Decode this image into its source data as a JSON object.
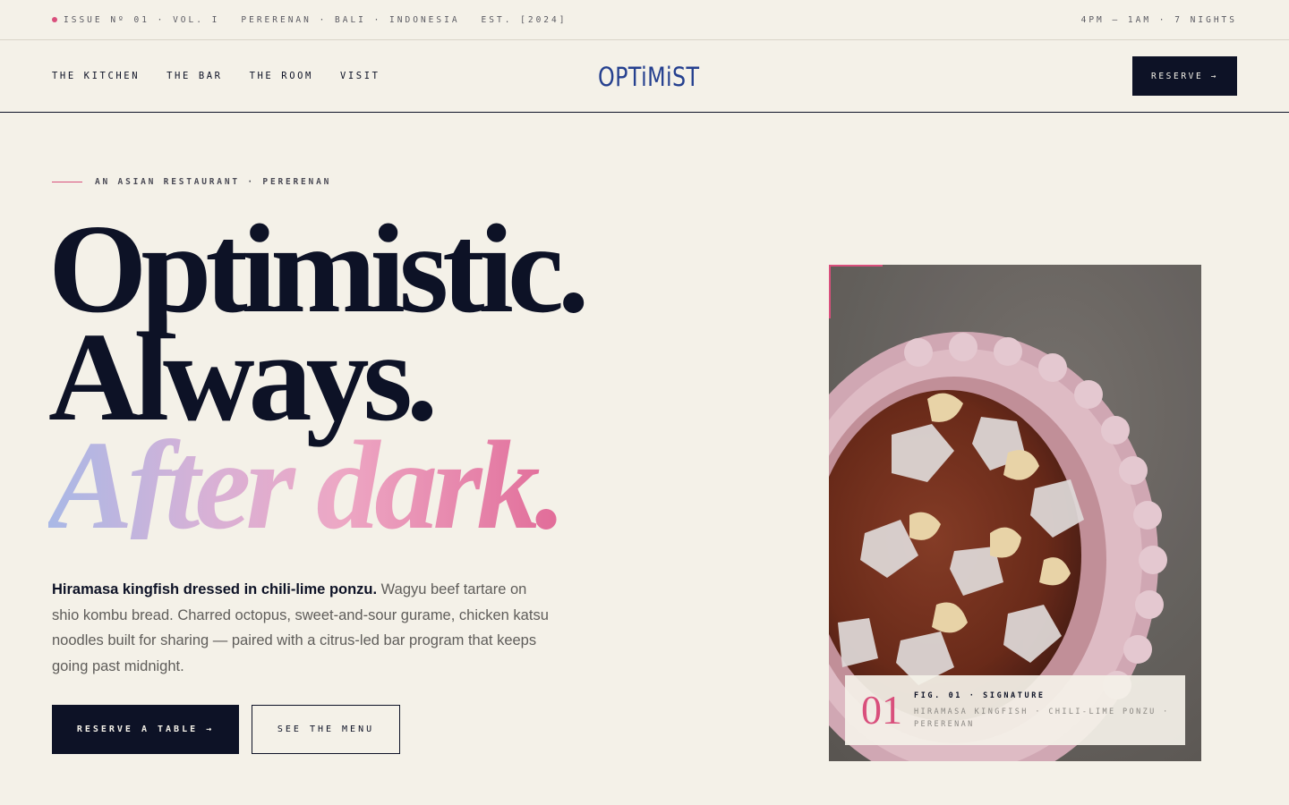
{
  "topbar": {
    "issue": "ISSUE Nº 01 · VOL. I",
    "location": "PERERENAN · BALI · INDONESIA",
    "established": "EST. [2024]",
    "hours": "4PM — 1AM · 7 NIGHTS"
  },
  "nav": {
    "links": [
      "THE KITCHEN",
      "THE BAR",
      "THE ROOM",
      "VISIT"
    ],
    "logo": "OPTiMiST",
    "reserve_label": "RESERVE →"
  },
  "hero": {
    "eyebrow": "AN ASIAN RESTAURANT · PERERENAN",
    "headline_line1": "Optimistic.",
    "headline_line2": "Always.",
    "headline_line3": "After dark.",
    "intro_strong": "Hiramasa kingfish dressed in chili-lime ponzu.",
    "intro_rest": " Wagyu beef tartare on shio kombu bread. Charred octopus, sweet-and-sour gurame, chicken katsu noodles built for sharing — paired with a citrus-led bar program that keeps going past midnight.",
    "primary_cta": "RESERVE A TABLE →",
    "secondary_cta": "SEE THE MENU"
  },
  "figure": {
    "number": "01",
    "label": "FIG. 01 · SIGNATURE",
    "description": "HIRAMASA KINGFISH · CHILI-LIME PONZU · PERERENAN"
  },
  "colors": {
    "background": "#f4f1e8",
    "ink": "#0d1226",
    "accent": "#d94f7c",
    "logo": "#25408f"
  }
}
